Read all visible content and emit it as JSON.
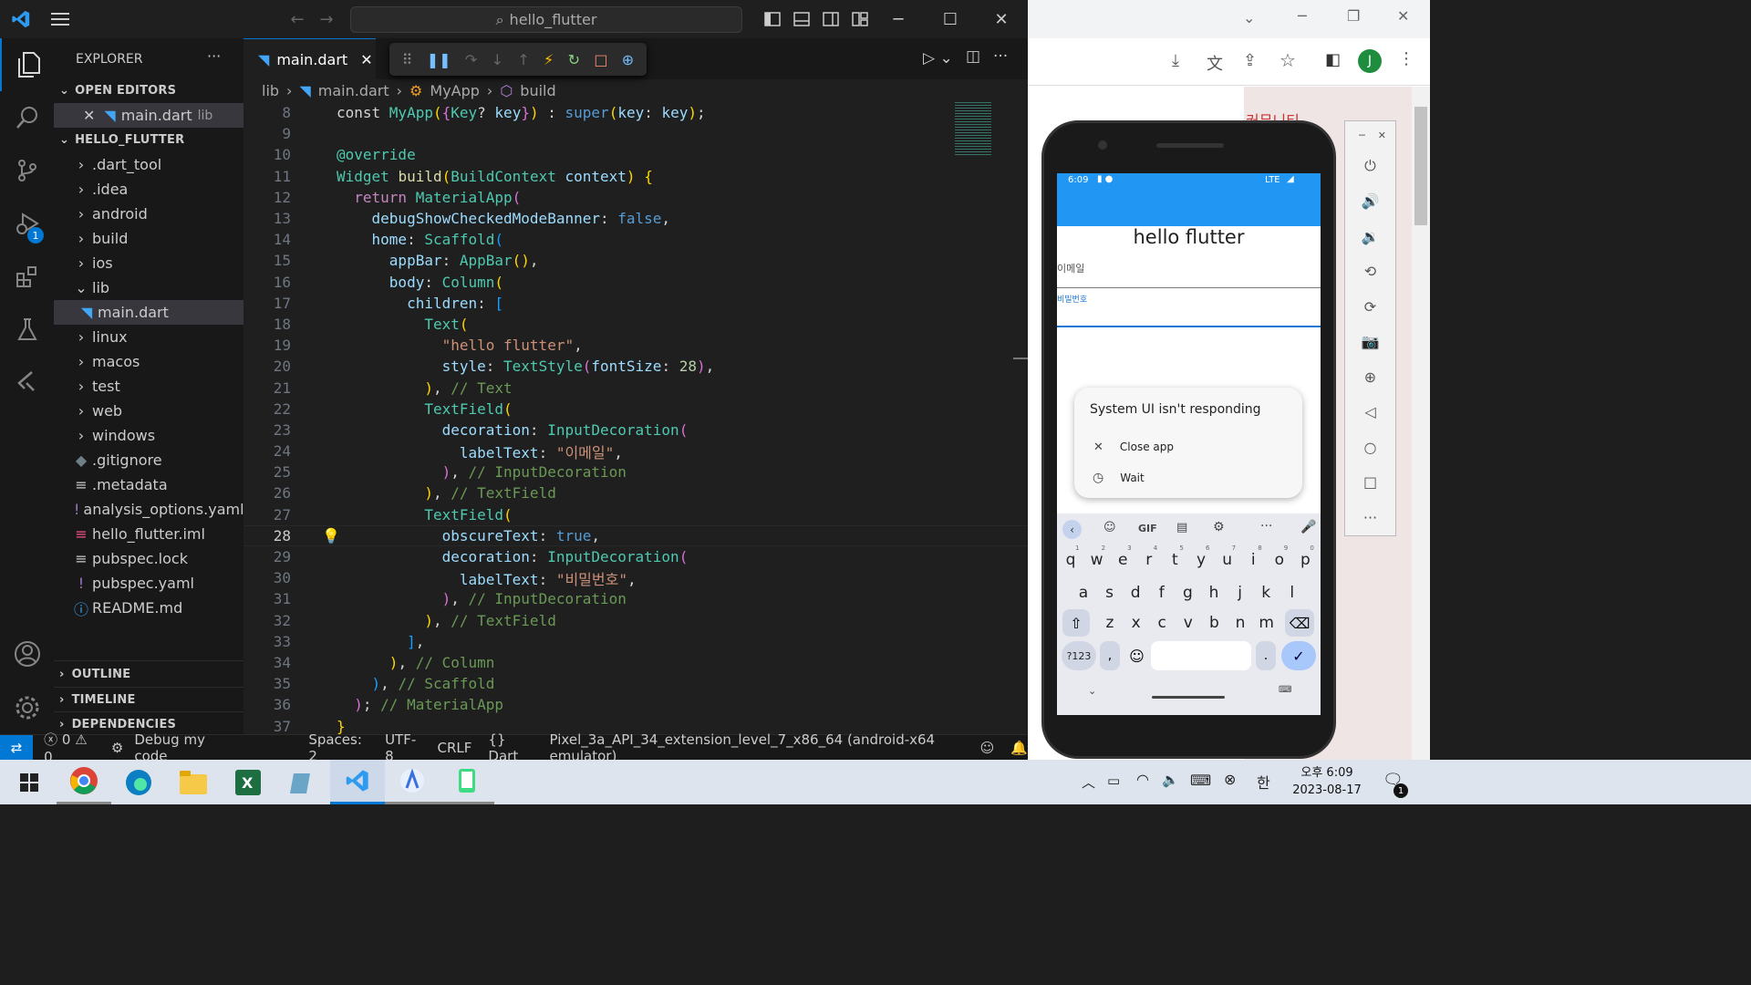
{
  "vscode": {
    "title_search": "hello_flutter",
    "activity_badge": "1",
    "explorer_title": "EXPLORER",
    "open_editors_header": "OPEN EDITORS",
    "open_editor_file": "main.dart",
    "open_editor_folder": "lib",
    "project_header": "HELLO_FLUTTER",
    "tree": [
      {
        "label": ".dart_tool",
        "type": "folder"
      },
      {
        "label": ".idea",
        "type": "folder"
      },
      {
        "label": "android",
        "type": "folder"
      },
      {
        "label": "build",
        "type": "folder"
      },
      {
        "label": "ios",
        "type": "folder"
      },
      {
        "label": "lib",
        "type": "folder-open"
      },
      {
        "label": "main.dart",
        "type": "dart",
        "selected": true
      },
      {
        "label": "linux",
        "type": "folder"
      },
      {
        "label": "macos",
        "type": "folder"
      },
      {
        "label": "test",
        "type": "folder"
      },
      {
        "label": "web",
        "type": "folder"
      },
      {
        "label": "windows",
        "type": "folder"
      },
      {
        "label": ".gitignore",
        "type": "git"
      },
      {
        "label": ".metadata",
        "type": "meta"
      },
      {
        "label": "analysis_options.yaml",
        "type": "yaml"
      },
      {
        "label": "hello_flutter.iml",
        "type": "iml"
      },
      {
        "label": "pubspec.lock",
        "type": "lock"
      },
      {
        "label": "pubspec.yaml",
        "type": "yaml"
      },
      {
        "label": "README.md",
        "type": "info"
      }
    ],
    "outline": "OUTLINE",
    "timeline": "TIMELINE",
    "dependencies": "DEPENDENCIES",
    "tab_label": "main.dart",
    "breadcrumb": [
      "lib",
      "main.dart",
      "MyApp",
      "build"
    ],
    "code_lines": [
      "8",
      "9",
      "10",
      "11",
      "12",
      "13",
      "14",
      "15",
      "16",
      "17",
      "18",
      "19",
      "20",
      "21",
      "22",
      "23",
      "24",
      "25",
      "26",
      "27",
      "28",
      "29",
      "30",
      "31",
      "32",
      "33",
      "34",
      "35",
      "36",
      "37"
    ],
    "current_line": "28",
    "status": {
      "errors": "0",
      "warnings": "0",
      "debug_text": "Debug my code",
      "spaces": "Spaces: 2",
      "encoding": "UTF-8",
      "eol": "CRLF",
      "language": "Dart",
      "device": "Pixel_3a_API_34_extension_level_7_x86_64 (android-x64 emulator)"
    }
  },
  "chrome": {
    "profile_initial": "J",
    "bg_text": "커뮤니티"
  },
  "phone": {
    "time": "6:09",
    "network": "LTE",
    "app_title": "hello flutter",
    "email_label": "이메일",
    "password_label": "비밀번호",
    "dialog": {
      "title": "System UI isn't responding",
      "close": "Close app",
      "wait": "Wait"
    },
    "kb_row1": [
      "q",
      "w",
      "e",
      "r",
      "t",
      "y",
      "u",
      "i",
      "o",
      "p"
    ],
    "kb_row1_hints": [
      "1",
      "2",
      "3",
      "4",
      "5",
      "6",
      "7",
      "8",
      "9",
      "0"
    ],
    "kb_row2": [
      "a",
      "s",
      "d",
      "f",
      "g",
      "h",
      "j",
      "k",
      "l"
    ],
    "kb_row3": [
      "z",
      "x",
      "c",
      "v",
      "b",
      "n",
      "m"
    ],
    "kb_sym": "?123",
    "kb_comma": ",",
    "kb_period": ".",
    "kb_gif": "GIF"
  },
  "taskbar": {
    "time": "오후 6:09",
    "date": "2023-08-17",
    "ime": "한",
    "notif_count": "1"
  },
  "colors": {
    "accent": "#0078d4",
    "dart_blue": "#42a5f5",
    "phone_appbar": "#2196f3",
    "status_bar": "#181818"
  }
}
